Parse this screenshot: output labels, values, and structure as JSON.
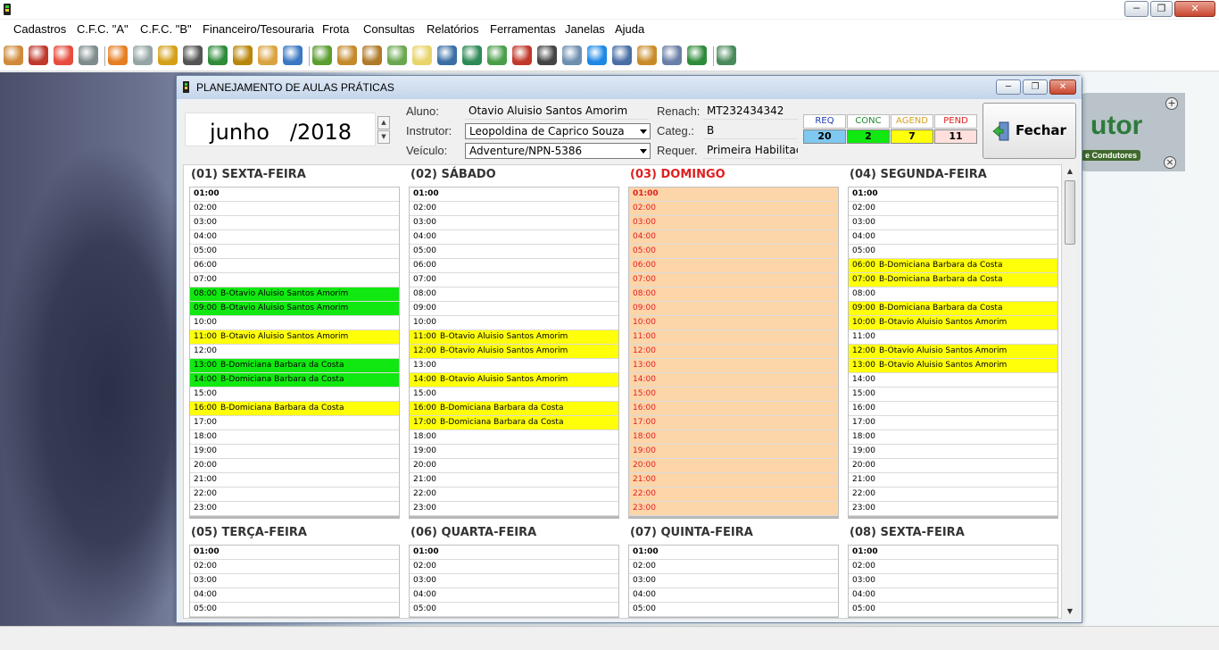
{
  "window": {
    "minimize": "─",
    "maximize": "❐",
    "close": "✕"
  },
  "menu": [
    "Cadastros",
    "C.F.C. \"A\"",
    "C.F.C. \"B\"",
    "Financeiro/Tesouraria",
    "Frota",
    "Consultas",
    "Relatórios",
    "Ferramentas",
    "Janelas",
    "Ajuda"
  ],
  "toolbar_icons": [
    "users-icon",
    "truck-icon",
    "house-icon",
    "car-icon",
    "handshake-icon",
    "document-edit-icon",
    "book-icon",
    "notebook-icon",
    "green-book-icon",
    "tools-icon",
    "clipboard-icon",
    "id-card-icon",
    "money-icon",
    "package-icon",
    "money-bag-icon",
    "money-add-icon",
    "notes-icon",
    "calculator-icon",
    "banknote-icon",
    "chart-icon",
    "lipstick-icon",
    "phone-icon",
    "mail-icon",
    "teamviewer-icon",
    "list-icon",
    "user-lock-icon",
    "gears-icon",
    "person-icon",
    "exit-icon"
  ],
  "logo": {
    "text": "utor",
    "sub": "e Condutores",
    "plus": "+",
    "x": "×"
  },
  "dialog": {
    "title": "PLANEJAMENTO DE AULAS PRÁTICAS",
    "min": "─",
    "max": "❐",
    "close": "✕",
    "month": "junho   /2018",
    "spin_up": "▲",
    "spin_down": "▼",
    "fields": {
      "aluno_label": "Aluno:",
      "aluno": "Otavio Aluisio Santos Amorim",
      "instrutor_label": "Instrutor:",
      "instrutor": "Leopoldina de Caprico Souza",
      "veiculo_label": "Veículo:",
      "veiculo": "Adventure/NPN-5386",
      "renach_label": "Renach:",
      "renach": "MT232434342",
      "categ_label": "Categ.:",
      "categ": "B",
      "requer_label": "Requer.",
      "requer": "Primeira Habilitação"
    },
    "counters": [
      {
        "label": "REQ",
        "value": "20",
        "label_color": "#1a3bb0",
        "value_bg": "#7fc8f0"
      },
      {
        "label": "CONC",
        "value": "2",
        "label_color": "#1e8a2e",
        "value_bg": "#11e811"
      },
      {
        "label": "AGEND",
        "value": "7",
        "label_color": "#d8a020",
        "value_bg": "#ffff0a"
      },
      {
        "label": "PEND",
        "value": "11",
        "label_color": "#e02020",
        "value_bg": "#ffe0dc"
      }
    ],
    "close_button": "Fechar"
  },
  "colors": {
    "conc": "#11e811",
    "agend": "#ffff0a",
    "sunday": "#fcd5a9"
  },
  "scrollbar": {
    "up": "▲",
    "down": "▼"
  },
  "days": [
    {
      "title": "(01) SEXTA-FEIRA",
      "sunday": false,
      "slots": [
        {
          "t": "01:00",
          "n": "",
          "s": ""
        },
        {
          "t": "02:00",
          "n": "",
          "s": ""
        },
        {
          "t": "03:00",
          "n": "",
          "s": ""
        },
        {
          "t": "04:00",
          "n": "",
          "s": ""
        },
        {
          "t": "05:00",
          "n": "",
          "s": ""
        },
        {
          "t": "06:00",
          "n": "",
          "s": ""
        },
        {
          "t": "07:00",
          "n": "",
          "s": ""
        },
        {
          "t": "08:00",
          "n": "B-Otavio Aluisio Santos Amorim",
          "s": "green"
        },
        {
          "t": "09:00",
          "n": "B-Otavio Aluisio Santos Amorim",
          "s": "green"
        },
        {
          "t": "10:00",
          "n": "",
          "s": ""
        },
        {
          "t": "11:00",
          "n": "B-Otavio Aluisio Santos Amorim",
          "s": "yellow"
        },
        {
          "t": "12:00",
          "n": "",
          "s": ""
        },
        {
          "t": "13:00",
          "n": "B-Domiciana Barbara da Costa",
          "s": "green"
        },
        {
          "t": "14:00",
          "n": "B-Domiciana Barbara da Costa",
          "s": "green"
        },
        {
          "t": "15:00",
          "n": "",
          "s": ""
        },
        {
          "t": "16:00",
          "n": "B-Domiciana Barbara da Costa",
          "s": "yellow"
        },
        {
          "t": "17:00",
          "n": "",
          "s": ""
        },
        {
          "t": "18:00",
          "n": "",
          "s": ""
        },
        {
          "t": "19:00",
          "n": "",
          "s": ""
        },
        {
          "t": "20:00",
          "n": "",
          "s": ""
        },
        {
          "t": "21:00",
          "n": "",
          "s": ""
        },
        {
          "t": "22:00",
          "n": "",
          "s": ""
        },
        {
          "t": "23:00",
          "n": "",
          "s": ""
        }
      ]
    },
    {
      "title": "(02) SÁBADO",
      "sunday": false,
      "slots": [
        {
          "t": "01:00",
          "n": "",
          "s": ""
        },
        {
          "t": "02:00",
          "n": "",
          "s": ""
        },
        {
          "t": "03:00",
          "n": "",
          "s": ""
        },
        {
          "t": "04:00",
          "n": "",
          "s": ""
        },
        {
          "t": "05:00",
          "n": "",
          "s": ""
        },
        {
          "t": "06:00",
          "n": "",
          "s": ""
        },
        {
          "t": "07:00",
          "n": "",
          "s": ""
        },
        {
          "t": "08:00",
          "n": "",
          "s": ""
        },
        {
          "t": "09:00",
          "n": "",
          "s": ""
        },
        {
          "t": "10:00",
          "n": "",
          "s": ""
        },
        {
          "t": "11:00",
          "n": "B-Otavio Aluisio Santos Amorim",
          "s": "yellow"
        },
        {
          "t": "12:00",
          "n": "B-Otavio Aluisio Santos Amorim",
          "s": "yellow"
        },
        {
          "t": "13:00",
          "n": "",
          "s": ""
        },
        {
          "t": "14:00",
          "n": "B-Otavio Aluisio Santos Amorim",
          "s": "yellow"
        },
        {
          "t": "15:00",
          "n": "",
          "s": ""
        },
        {
          "t": "16:00",
          "n": "B-Domiciana Barbara da Costa",
          "s": "yellow"
        },
        {
          "t": "17:00",
          "n": "B-Domiciana Barbara da Costa",
          "s": "yellow"
        },
        {
          "t": "18:00",
          "n": "",
          "s": ""
        },
        {
          "t": "19:00",
          "n": "",
          "s": ""
        },
        {
          "t": "20:00",
          "n": "",
          "s": ""
        },
        {
          "t": "21:00",
          "n": "",
          "s": ""
        },
        {
          "t": "22:00",
          "n": "",
          "s": ""
        },
        {
          "t": "23:00",
          "n": "",
          "s": ""
        }
      ]
    },
    {
      "title": "(03) DOMINGO",
      "sunday": true,
      "slots": [
        {
          "t": "01:00",
          "n": "",
          "s": "sun"
        },
        {
          "t": "02:00",
          "n": "",
          "s": "sun"
        },
        {
          "t": "03:00",
          "n": "",
          "s": "sun"
        },
        {
          "t": "04:00",
          "n": "",
          "s": "sun"
        },
        {
          "t": "05:00",
          "n": "",
          "s": "sun"
        },
        {
          "t": "06:00",
          "n": "",
          "s": "sun"
        },
        {
          "t": "07:00",
          "n": "",
          "s": "sun"
        },
        {
          "t": "08:00",
          "n": "",
          "s": "sun"
        },
        {
          "t": "09:00",
          "n": "",
          "s": "sun"
        },
        {
          "t": "10:00",
          "n": "",
          "s": "sun"
        },
        {
          "t": "11:00",
          "n": "",
          "s": "sun"
        },
        {
          "t": "12:00",
          "n": "",
          "s": "sun"
        },
        {
          "t": "13:00",
          "n": "",
          "s": "sun"
        },
        {
          "t": "14:00",
          "n": "",
          "s": "sun"
        },
        {
          "t": "15:00",
          "n": "",
          "s": "sun"
        },
        {
          "t": "16:00",
          "n": "",
          "s": "sun"
        },
        {
          "t": "17:00",
          "n": "",
          "s": "sun"
        },
        {
          "t": "18:00",
          "n": "",
          "s": "sun"
        },
        {
          "t": "19:00",
          "n": "",
          "s": "sun"
        },
        {
          "t": "20:00",
          "n": "",
          "s": "sun"
        },
        {
          "t": "21:00",
          "n": "",
          "s": "sun"
        },
        {
          "t": "22:00",
          "n": "",
          "s": "sun"
        },
        {
          "t": "23:00",
          "n": "",
          "s": "sun"
        }
      ]
    },
    {
      "title": "(04) SEGUNDA-FEIRA",
      "sunday": false,
      "slots": [
        {
          "t": "01:00",
          "n": "",
          "s": ""
        },
        {
          "t": "02:00",
          "n": "",
          "s": ""
        },
        {
          "t": "03:00",
          "n": "",
          "s": ""
        },
        {
          "t": "04:00",
          "n": "",
          "s": ""
        },
        {
          "t": "05:00",
          "n": "",
          "s": ""
        },
        {
          "t": "06:00",
          "n": "B-Domiciana Barbara da Costa",
          "s": "yellow"
        },
        {
          "t": "07:00",
          "n": "B-Domiciana Barbara da Costa",
          "s": "yellow"
        },
        {
          "t": "08:00",
          "n": "",
          "s": ""
        },
        {
          "t": "09:00",
          "n": "B-Domiciana Barbara da Costa",
          "s": "yellow"
        },
        {
          "t": "10:00",
          "n": "B-Otavio Aluisio Santos Amorim",
          "s": "yellow"
        },
        {
          "t": "11:00",
          "n": "",
          "s": ""
        },
        {
          "t": "12:00",
          "n": "B-Otavio Aluisio Santos Amorim",
          "s": "yellow"
        },
        {
          "t": "13:00",
          "n": "B-Otavio Aluisio Santos Amorim",
          "s": "yellow"
        },
        {
          "t": "14:00",
          "n": "",
          "s": ""
        },
        {
          "t": "15:00",
          "n": "",
          "s": ""
        },
        {
          "t": "16:00",
          "n": "",
          "s": ""
        },
        {
          "t": "17:00",
          "n": "",
          "s": ""
        },
        {
          "t": "18:00",
          "n": "",
          "s": ""
        },
        {
          "t": "19:00",
          "n": "",
          "s": ""
        },
        {
          "t": "20:00",
          "n": "",
          "s": ""
        },
        {
          "t": "21:00",
          "n": "",
          "s": ""
        },
        {
          "t": "22:00",
          "n": "",
          "s": ""
        },
        {
          "t": "23:00",
          "n": "",
          "s": ""
        }
      ]
    },
    {
      "title": "(05) TERÇA-FEIRA",
      "sunday": false,
      "slots": [
        {
          "t": "01:00",
          "n": "",
          "s": ""
        },
        {
          "t": "02:00",
          "n": "",
          "s": ""
        },
        {
          "t": "03:00",
          "n": "",
          "s": ""
        },
        {
          "t": "04:00",
          "n": "",
          "s": ""
        },
        {
          "t": "05:00",
          "n": "",
          "s": ""
        }
      ]
    },
    {
      "title": "(06) QUARTA-FEIRA",
      "sunday": false,
      "slots": [
        {
          "t": "01:00",
          "n": "",
          "s": ""
        },
        {
          "t": "02:00",
          "n": "",
          "s": ""
        },
        {
          "t": "03:00",
          "n": "",
          "s": ""
        },
        {
          "t": "04:00",
          "n": "",
          "s": ""
        },
        {
          "t": "05:00",
          "n": "",
          "s": ""
        }
      ]
    },
    {
      "title": "(07) QUINTA-FEIRA",
      "sunday": false,
      "slots": [
        {
          "t": "01:00",
          "n": "",
          "s": ""
        },
        {
          "t": "02:00",
          "n": "",
          "s": ""
        },
        {
          "t": "03:00",
          "n": "",
          "s": ""
        },
        {
          "t": "04:00",
          "n": "",
          "s": ""
        },
        {
          "t": "05:00",
          "n": "",
          "s": ""
        }
      ]
    },
    {
      "title": "(08) SEXTA-FEIRA",
      "sunday": false,
      "slots": [
        {
          "t": "01:00",
          "n": "",
          "s": ""
        },
        {
          "t": "02:00",
          "n": "",
          "s": ""
        },
        {
          "t": "03:00",
          "n": "",
          "s": ""
        },
        {
          "t": "04:00",
          "n": "",
          "s": ""
        },
        {
          "t": "05:00",
          "n": "",
          "s": ""
        }
      ]
    }
  ]
}
